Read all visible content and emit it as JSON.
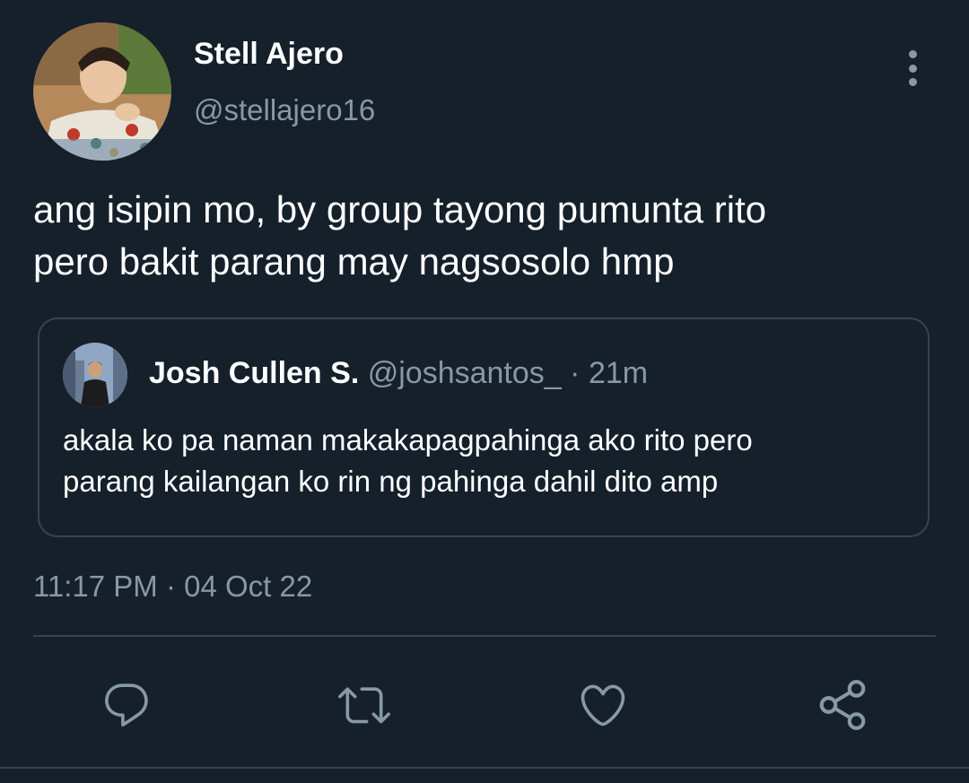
{
  "tweet": {
    "author_name": "Stell Ajero",
    "author_handle": "@stellajero16",
    "text_lines": [
      "ang isipin mo, by group tayong pumunta rito",
      "pero bakit parang may nagsosolo hmp"
    ],
    "timestamp": "11:17 PM · 04 Oct 22"
  },
  "quoted_tweet": {
    "author_name": "Josh Cullen S.",
    "author_handle": "@joshsantos_",
    "separator": "·",
    "time": "21m",
    "text_lines": [
      "akala ko pa naman makakapagpahinga ako rito pero",
      "parang kailangan ko rin ng pahinga dahil dito amp"
    ]
  },
  "actions": {
    "icons": [
      "reply-icon",
      "retweet-icon",
      "like-icon",
      "share-icon"
    ]
  },
  "colors": {
    "background": "#15202b",
    "primary_text": "#ffffff",
    "secondary_text": "#8899a6",
    "border": "#38444d"
  }
}
